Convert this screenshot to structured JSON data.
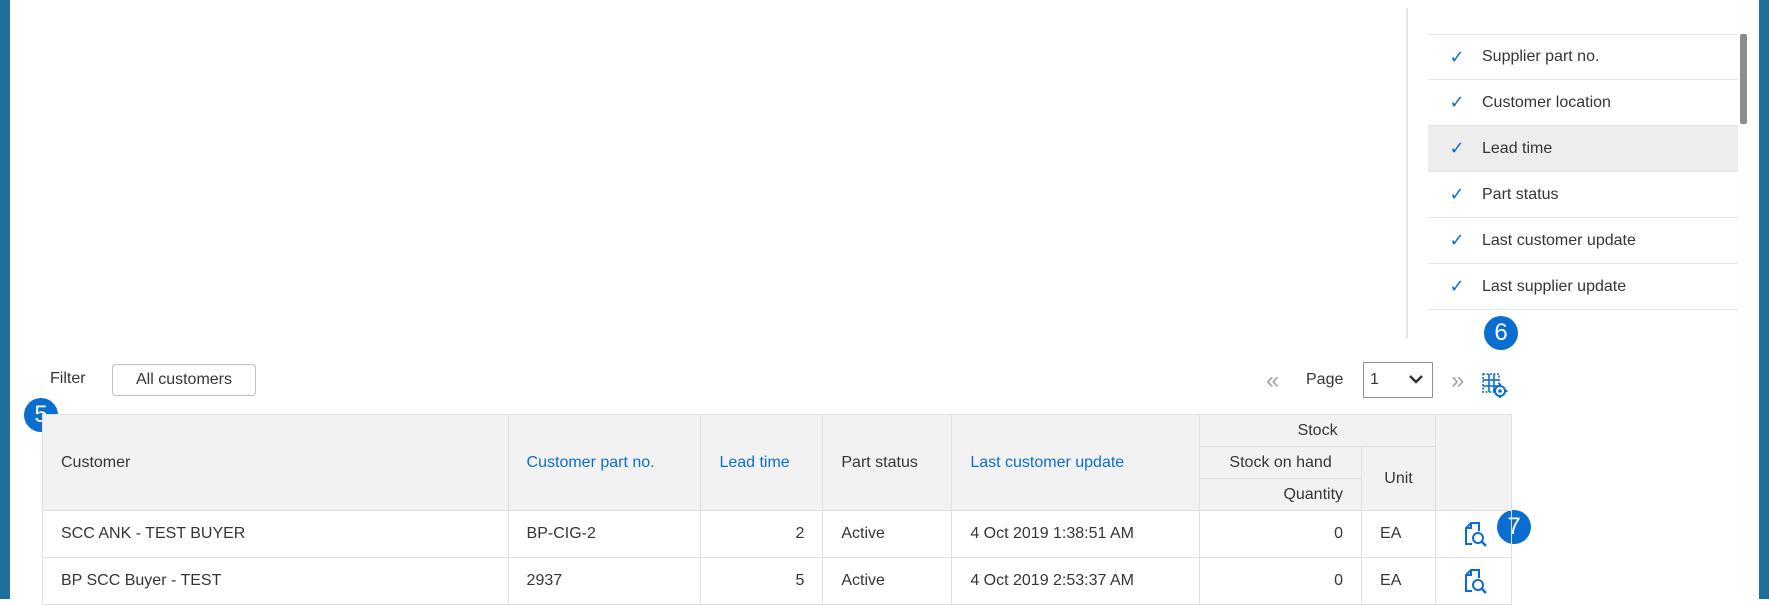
{
  "column_picker": {
    "items": [
      {
        "label": "Supplier part no.",
        "checked": true
      },
      {
        "label": "Customer location",
        "checked": true
      },
      {
        "label": "Lead time",
        "checked": true,
        "highlighted": true
      },
      {
        "label": "Part status",
        "checked": true
      },
      {
        "label": "Last customer update",
        "checked": true
      },
      {
        "label": "Last supplier update",
        "checked": true
      }
    ],
    "check_glyph": "✓"
  },
  "callouts": {
    "c5": "5",
    "c6": "6",
    "c7": "7"
  },
  "toolbar": {
    "filter_label": "Filter",
    "filter_button": "All customers",
    "prev_glyph": "«",
    "page_label": "Page",
    "page_value": "1",
    "next_glyph": "»",
    "settings_icon": "table-settings-icon"
  },
  "table": {
    "headers": {
      "customer": "Customer",
      "customer_part_no": "Customer part no.",
      "lead_time": "Lead time",
      "part_status": "Part status",
      "last_customer_update": "Last customer update",
      "stock_group": "Stock",
      "stock_on_hand": "Stock on hand",
      "quantity": "Quantity",
      "unit": "Unit"
    },
    "rows": [
      {
        "customer": "SCC ANK - TEST BUYER",
        "customer_part_no": "BP-CIG-2",
        "lead_time": "2",
        "part_status": "Active",
        "last_customer_update": "4 Oct 2019 1:38:51 AM",
        "quantity": "0",
        "unit": "EA"
      },
      {
        "customer": "BP SCC Buyer - TEST",
        "customer_part_no": "2937",
        "lead_time": "5",
        "part_status": "Active",
        "last_customer_update": "4 Oct 2019 2:53:37 AM",
        "quantity": "0",
        "unit": "EA"
      }
    ]
  },
  "colors": {
    "accent": "#0a6ed1",
    "frame": "#1f6f9d",
    "header_bg": "#f2f2f2"
  }
}
